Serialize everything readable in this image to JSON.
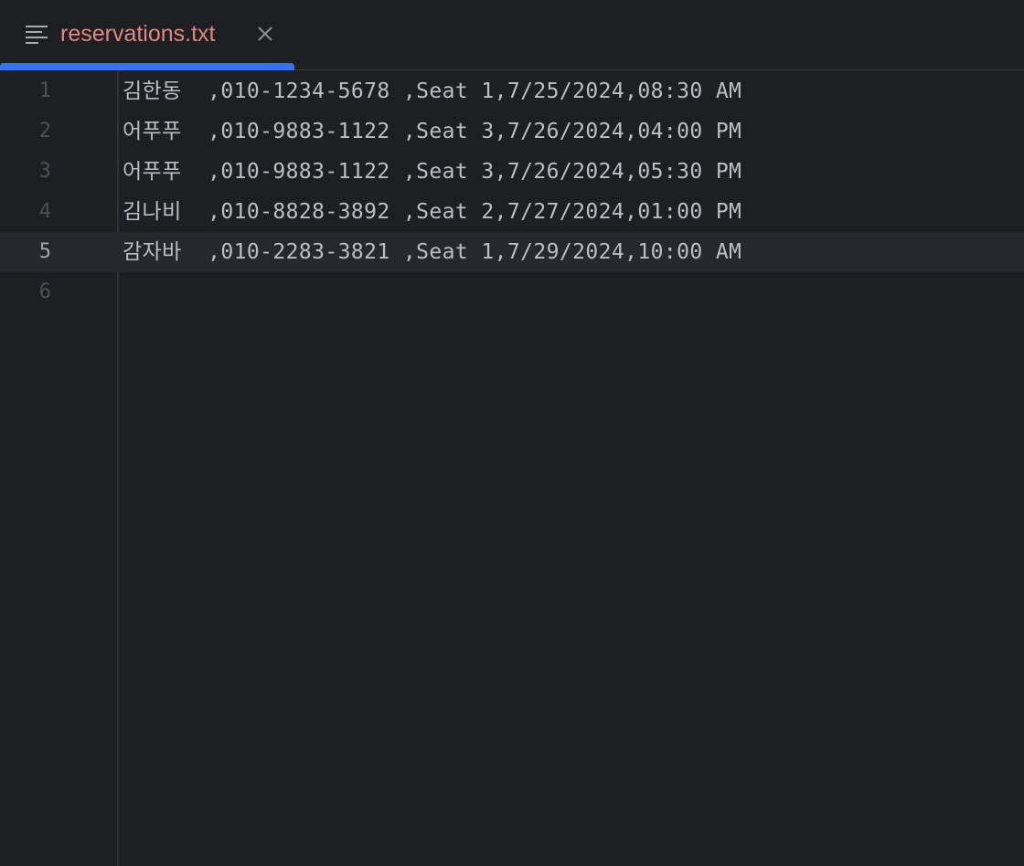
{
  "tab": {
    "label": "reservations.txt",
    "file_icon": "text-file-lines-icon",
    "close_icon": "close-icon"
  },
  "colors": {
    "background": "#1e1f22",
    "tab_label": "#e0877f",
    "tab_underline": "#3574f0",
    "text": "#bcbec4",
    "line_number": "#4b5059",
    "current_line_bg": "#26282e"
  },
  "editor": {
    "current_line": 5,
    "lines": [
      {
        "number": "1",
        "text": "김한동  ,010-1234-5678 ,Seat 1,7/25/2024,08:30 AM"
      },
      {
        "number": "2",
        "text": "어푸푸  ,010-9883-1122 ,Seat 3,7/26/2024,04:00 PM"
      },
      {
        "number": "3",
        "text": "어푸푸  ,010-9883-1122 ,Seat 3,7/26/2024,05:30 PM"
      },
      {
        "number": "4",
        "text": "김나비  ,010-8828-3892 ,Seat 2,7/27/2024,01:00 PM"
      },
      {
        "number": "5",
        "text": "감자바  ,010-2283-3821 ,Seat 1,7/29/2024,10:00 AM"
      },
      {
        "number": "6",
        "text": ""
      }
    ]
  }
}
